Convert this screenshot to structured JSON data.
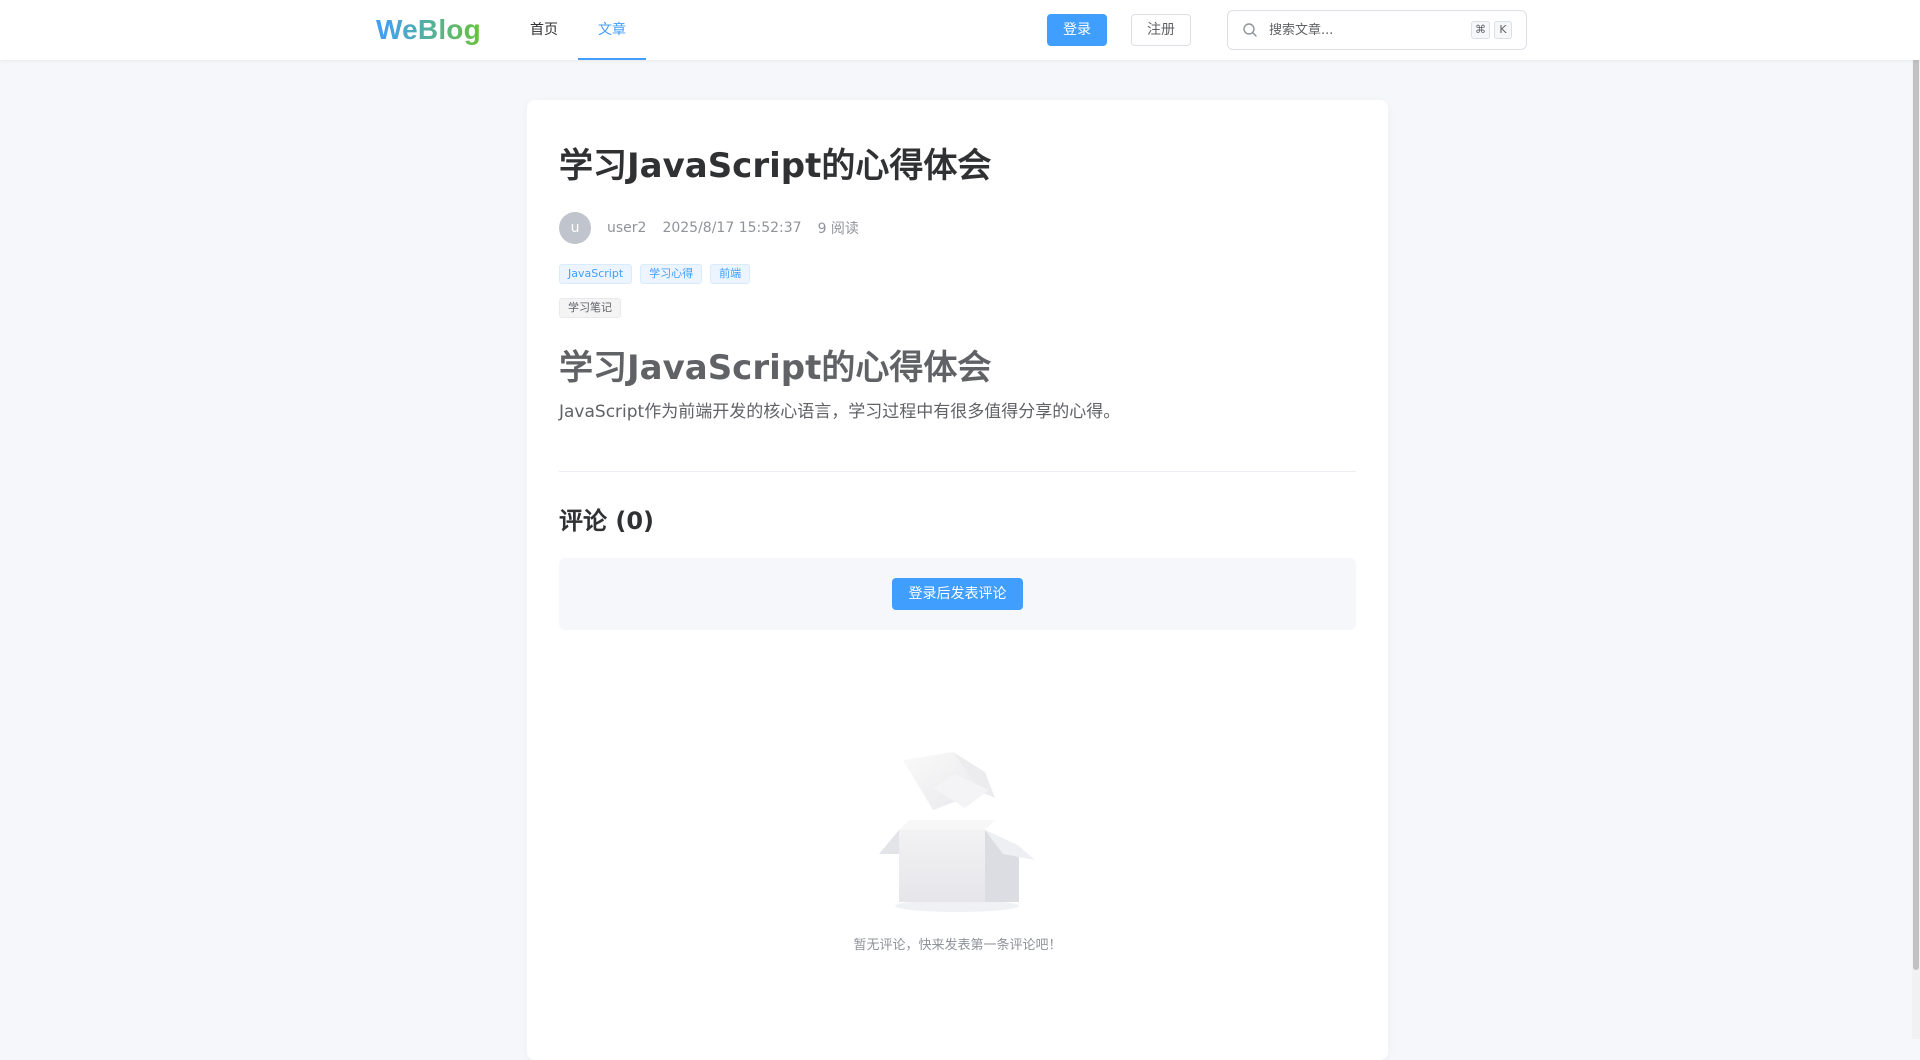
{
  "header": {
    "logo": "WeBlog",
    "nav": [
      {
        "label": "首页"
      },
      {
        "label": "文章"
      }
    ],
    "login_label": "登录",
    "register_label": "注册",
    "search_placeholder": "搜索文章...",
    "shortcut_keys": [
      "⌘",
      "K"
    ]
  },
  "article": {
    "title": "学习JavaScript的心得体会",
    "author_initial": "u",
    "author": "user2",
    "date": "2025/8/17 15:52:37",
    "reads": "9 阅读",
    "tags": [
      "JavaScript",
      "学习心得",
      "前端"
    ],
    "category_tag": "学习笔记",
    "content_heading": "学习JavaScript的心得体会",
    "content_paragraph": "JavaScript作为前端开发的核心语言，学习过程中有很多值得分享的心得。"
  },
  "comments": {
    "title": "评论 (0)",
    "login_to_comment": "登录后发表评论",
    "empty_text": "暂无评论，快来发表第一条评论吧！"
  },
  "colors": {
    "primary": "#409eff",
    "logo_gradient_end": "#67c23a",
    "background": "#f5f7fa"
  },
  "icons": {
    "search": "search-icon",
    "empty": "empty-box-icon"
  }
}
